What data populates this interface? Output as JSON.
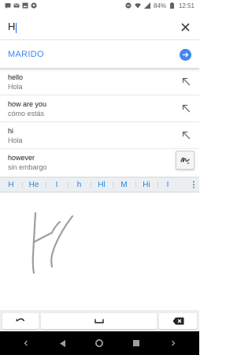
{
  "status_bar": {
    "battery_percent": "84%",
    "time": "12:51",
    "icons": [
      "message-icon",
      "gmail-icon",
      "photo-icon",
      "soccer-icon"
    ],
    "right_icons": [
      "do-not-disturb-icon",
      "wifi-icon",
      "signal-icon",
      "battery-icon"
    ]
  },
  "input": {
    "value": "H"
  },
  "translation": {
    "text": "MARIDO"
  },
  "suggestions": [
    {
      "primary": "hello",
      "secondary": "Hola"
    },
    {
      "primary": "how are you",
      "secondary": "cómo estás"
    },
    {
      "primary": "hi",
      "secondary": "Hola"
    },
    {
      "primary": "however",
      "secondary": "sin embargo"
    }
  ],
  "candidates": [
    "H",
    "He",
    "I",
    "h",
    "Hl",
    "M",
    "Hi",
    "I"
  ],
  "colors": {
    "accent": "#4285f4",
    "candidate_text": "#1e88e5",
    "ink": "#9e9e9e"
  }
}
